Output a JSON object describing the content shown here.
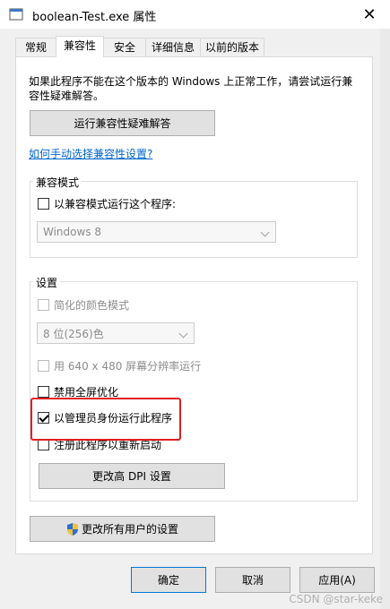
{
  "window": {
    "title": "boolean-Test.exe 属性",
    "close_icon": "close-icon"
  },
  "tabs": [
    {
      "label": "常规",
      "active": false
    },
    {
      "label": "兼容性",
      "active": true
    },
    {
      "label": "安全",
      "active": false
    },
    {
      "label": "详细信息",
      "active": false
    },
    {
      "label": "以前的版本",
      "active": false
    }
  ],
  "intro": {
    "line1": "如果此程序不能在这个版本的 Windows 上正常工作，请尝试运行兼",
    "line2": "容性疑难解答。"
  },
  "troubleshoot_button": "运行兼容性疑难解答",
  "manual_link": "如何手动选择兼容性设置?",
  "compat_mode": {
    "group_label": "兼容模式",
    "checkbox_label": "以兼容模式运行这个程序:",
    "checked": false,
    "select_value": "Windows 8"
  },
  "settings": {
    "group_label": "设置",
    "reduced_color": {
      "label": "简化的颜色模式",
      "checked": false,
      "enabled": false
    },
    "color_select_value": "8 位(256)色",
    "res_640": {
      "label": "用 640 x 480 屏幕分辨率运行",
      "checked": false,
      "enabled": false
    },
    "disable_fullscreen": {
      "label": "禁用全屏优化",
      "checked": false,
      "enabled": true
    },
    "run_as_admin": {
      "label": "以管理员身份运行此程序",
      "checked": true,
      "enabled": true
    },
    "register_restart": {
      "label": "注册此程序以重新启动",
      "checked": false,
      "enabled": true
    },
    "dpi_button": "更改高 DPI 设置"
  },
  "all_users_button": "更改所有用户的设置",
  "footer": {
    "ok": "确定",
    "cancel": "取消",
    "apply": "应用(A)"
  },
  "watermark": "CSDN @star-keke",
  "colors": {
    "highlight": "#e02020",
    "link": "#0066cc",
    "primary_border": "#0078d7"
  }
}
